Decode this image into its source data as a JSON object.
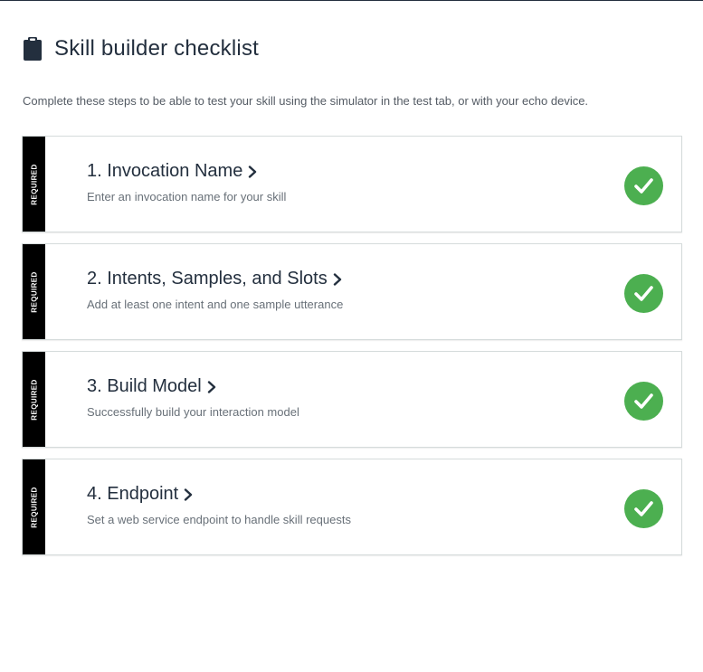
{
  "header": {
    "title": "Skill builder checklist",
    "icon": "clipboard-icon"
  },
  "description": "Complete these steps to be able to test your skill using the simulator in the test tab, or with your echo device.",
  "colors": {
    "required_tab": "#000000",
    "check_green": "#4caf50",
    "title_text": "#232f3e"
  },
  "steps": [
    {
      "required_label": "REQUIRED",
      "title": "1. Invocation Name",
      "subtitle": "Enter an invocation name for your skill",
      "status_icon": "check-circle-icon"
    },
    {
      "required_label": "REQUIRED",
      "title": "2. Intents, Samples, and Slots",
      "subtitle": "Add at least one intent and one sample utterance",
      "status_icon": "check-circle-icon"
    },
    {
      "required_label": "REQUIRED",
      "title": "3. Build Model",
      "subtitle": "Successfully build your interaction model",
      "status_icon": "check-circle-icon"
    },
    {
      "required_label": "REQUIRED",
      "title": "4. Endpoint",
      "subtitle": "Set a web service endpoint to handle skill requests",
      "status_icon": "check-circle-icon"
    }
  ]
}
